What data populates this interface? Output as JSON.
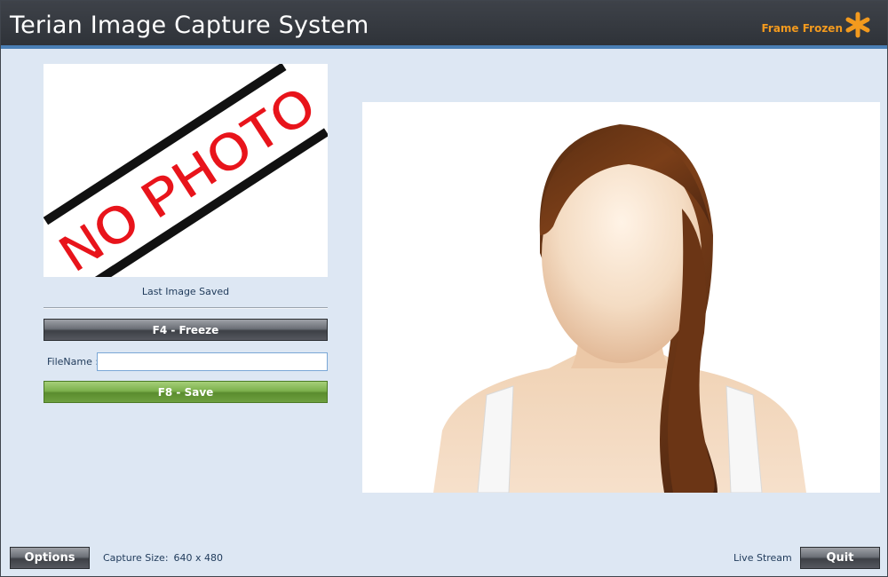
{
  "app": {
    "title": "Terian Image Capture System",
    "status": "Frame Frozen",
    "status_icon": "asterisk-icon",
    "accent_color": "#f39a1e"
  },
  "last_image": {
    "stamp_text": "NO PHOTO",
    "caption": "Last Image Saved"
  },
  "controls": {
    "freeze_label": "F4 - Freeze",
    "filename_label": "FileName :",
    "filename_value": "",
    "save_label": "F8 - Save"
  },
  "live_view": {
    "image": "placeholder-portrait-woman"
  },
  "footer": {
    "options_label": "Options",
    "capture_size_label": "Capture Size:",
    "capture_size_value": "640 x 480",
    "live_stream_label": "Live Stream",
    "quit_label": "Quit"
  }
}
